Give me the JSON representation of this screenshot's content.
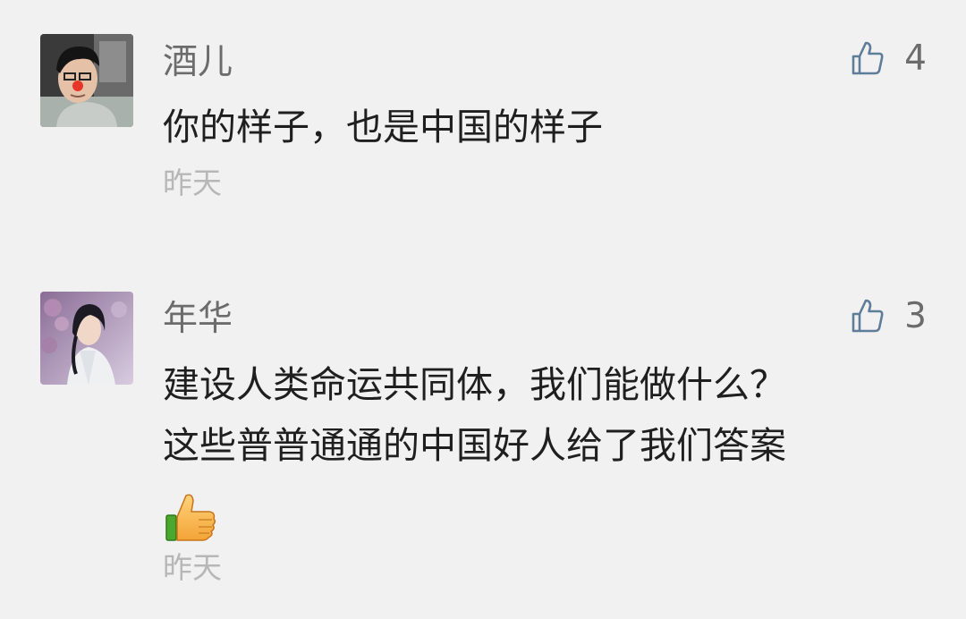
{
  "comments": [
    {
      "nickname": "酒儿",
      "likes": "4",
      "content": [
        "你的样子，也是中国的样子"
      ],
      "time": "昨天"
    },
    {
      "nickname": "年华",
      "likes": "3",
      "content": [
        "建设人类命运共同体，我们能做什么？",
        "这些普普通通的中国好人给了我们答案"
      ],
      "emoji": "thumbs-up-emoji",
      "time": "昨天"
    }
  ],
  "colors": {
    "background": "#f1f1f1",
    "nickname": "#6c6c6c",
    "content": "#1f1f1f",
    "time": "#b7b7b7",
    "like_icon": "#5f7c99"
  }
}
